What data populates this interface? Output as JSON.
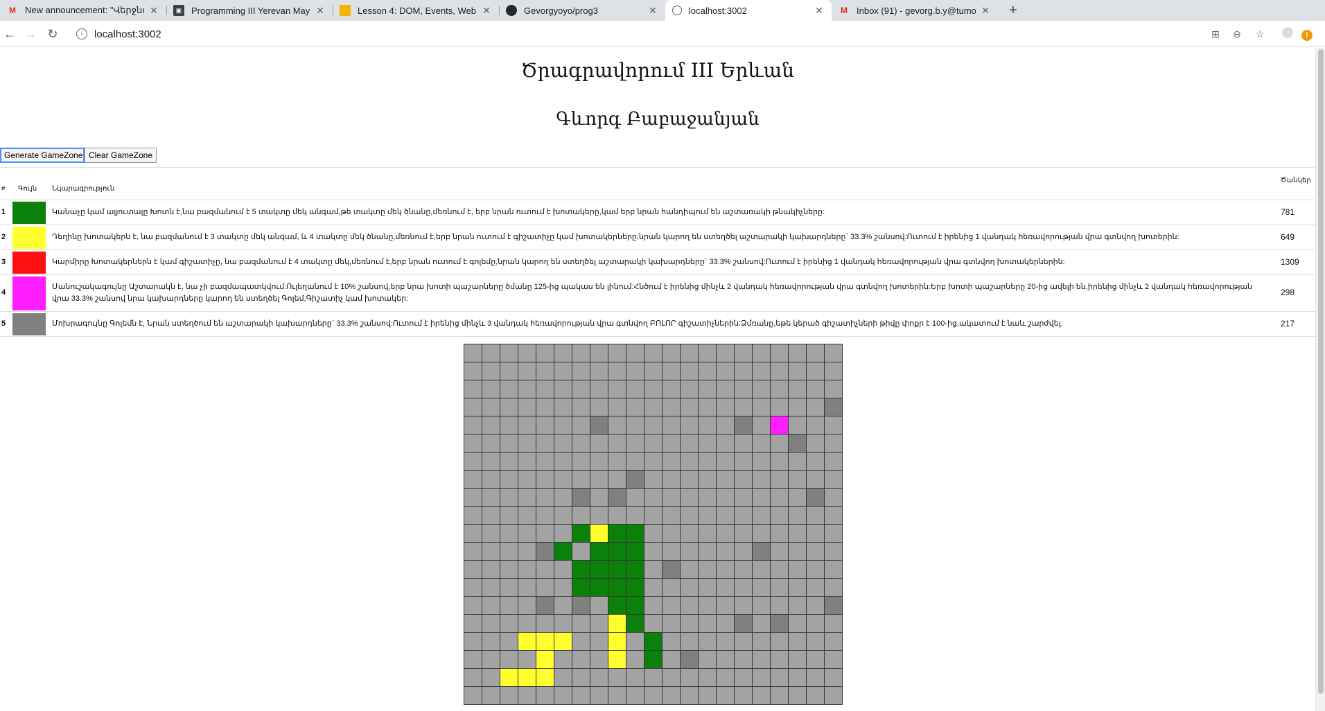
{
  "browser": {
    "tabs": [
      {
        "icon": "gmail-icon",
        "title": "New announcement: \"Վերջնակ",
        "active": false
      },
      {
        "icon": "classroom-icon",
        "title": "Programming III Yerevan May",
        "active": false
      },
      {
        "icon": "slides-icon",
        "title": "Lesson 4: DOM, Events, WebS",
        "active": false
      },
      {
        "icon": "github-icon",
        "title": "Gevorgyoyo/prog3",
        "active": false
      },
      {
        "icon": "globe-icon",
        "title": "localhost:3002",
        "active": true
      },
      {
        "icon": "gmail-icon",
        "title": "Inbox (91) - gevorg.b.y@tumo.",
        "active": false
      }
    ],
    "url": "localhost:3002"
  },
  "page": {
    "title": "Ծրագրավորում III Երևան",
    "author": "Գևորգ Բաբաջանյան",
    "buttons": {
      "generate": "Generate GameZone",
      "clear": "Clear GameZone"
    },
    "table": {
      "headers": {
        "num": "#",
        "color": "Գույն",
        "description": "Նկարագրություն",
        "count": "Ծանկեր"
      },
      "rows": [
        {
          "num": "1",
          "color": "#0b800b",
          "description": "Կանաչը կամ ալյուտալը Խոտն է,նա բազմանում է 5 տակտը մեկ անգամ,թե տակտը մեկ ծնանը,մեռնում է, երբ նրան ուտում է խոտակերը,կամ երբ նրան հանդիպում են աշտառակի թնակիչները:",
          "count": "781"
        },
        {
          "num": "2",
          "color": "#ffff2e",
          "description": "Դեղինը խոտակերն է, նա բազմանում է 3 տակտը մեկ անգամ, և 4 տակտը մեկ ծնանը,մեռնում է,երբ նրան ուտում է գիշատիչը կամ խոտակերները,նրան կարող են ստեղծել աշտարակի կախարդները` 33.3% շանսով:Ուտում է իրենից 1 վանդակ հեռավորության վրա գտնվող խոտերին:",
          "count": "649"
        },
        {
          "num": "3",
          "color": "#ff1111",
          "description": "Կարմիրը Խոտակերներն է կամ գիշատիչը, նա բազմանում է 4 տակտը մեկ,մեռնում է,երբ նրան ուտում է գոլեմը,նրան կարող են ստեղծել աշտարակի կախարդները` 33.3% շանսով:Ուտում է իրենից 1 վանդակ հեռավորության վրա գտնվող խոտակերներին:",
          "count": "1309"
        },
        {
          "num": "4",
          "color": "#ff1eff",
          "description": "Մանուշակագույնը Աշտարակն է, նա չի բազմապատկվում:Ուլեղանում է 10% շանսով,երբ նրա խոտի պաշարները ծմանը 125-ից պակաս են լինում:Հնծում է իրենից մինչև 2 վանդակ հեռավորության վրա գտնվող խոտերին:Երբ խոտի պաշարները 20-ից ավելի են,իրենից մինչև 2 վանդակ հեռավորության վրա 33.3% շանսով նրա կախարդները կարող են ստեղծել Գոլեմ,Գիշատիչ կամ խոտակեր:",
          "count": "298"
        },
        {
          "num": "5",
          "color": "#808080",
          "description": "Մոխրագույնը Գոլեմն է, Նրան ստեղծում են աշտարակի կախարդները` 33.3% շանսով:Ուտում է իրենից մինչև 3 վանդակ հեռավորության վրա գտնվող ԲՈԼՈՐ գիշատիչներին:Ձմռանը,եթե կերած գիշատիչների թիվը փոքր է 100-ից,ակատում է նաև շարժվել:",
          "count": "217"
        }
      ]
    },
    "grid": {
      "cols": 21,
      "rows": 20,
      "legend": {
        "0": "#a3a3a3",
        "1": "#0b800b",
        "2": "#ffff2e",
        "3": "#ff1111",
        "4": "#ff1eff",
        "5": "#808080"
      },
      "cells": [
        "000000000000000000000",
        "000000000000000000000",
        "000000000000000000000",
        "000000000000000000005",
        "000000050000000504000",
        "000000000000000000500",
        "000000000000000000000",
        "000000000500000000000",
        "000000505000000000050",
        "000000000000000000000",
        "000000121100000000000",
        "000051011100000050000",
        "000000111105000000000",
        "000000111100000000000",
        "000050501100000000005",
        "000000002100000505000",
        "000222002010000000000",
        "000020002010500000000",
        "002220000000000000000",
        "000000000000000000000"
      ]
    }
  }
}
